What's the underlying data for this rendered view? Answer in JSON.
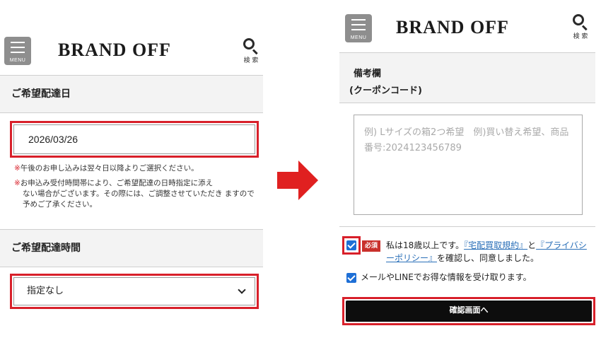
{
  "left_panel": {
    "header": {
      "menu_label": "MENU",
      "logo": "BRAND OFF",
      "search_label": "検 索"
    },
    "delivery_date": {
      "title": "ご希望配達日",
      "value": "2026/03/26",
      "notes": [
        {
          "mark": "※",
          "text": "午後のお申し込みは翌々日以降よりご選択ください。"
        },
        {
          "mark": "※",
          "text_line1": "お申込み受付時間帯により、ご希望配達の日時指定に添え",
          "text_rest": "ない場合がございます。その際には、ご調整させていただき ますので予めご了承ください。"
        }
      ]
    },
    "delivery_time": {
      "title": "ご希望配達時間",
      "selected": "指定なし"
    }
  },
  "right_panel": {
    "header": {
      "menu_label": "MENU",
      "logo": "BRAND OFF",
      "search_label": "検 索"
    },
    "remarks": {
      "title": "備考欄",
      "subtitle": "(クーポンコード)",
      "placeholder": "例) Lサイズの箱2つ希望　例)買い替え希望、商品番号:2024123456789"
    },
    "consent": {
      "required_badge": "必須",
      "text_before": "私は18歳以上です。",
      "link1": "『宅配買取規約』",
      "text_mid": "と",
      "link2": "『プライバシーポリシー』",
      "text_after": "を確認し、同意しました。"
    },
    "newsletter": {
      "text": "メールやLINEでお得な情報を受け取ります。"
    },
    "confirm_button": "確認画面へ"
  },
  "colors": {
    "highlight": "#d8202a",
    "arrow": "#e02020",
    "checkbox": "#1e6fd6",
    "button": "#0d0d0d"
  }
}
